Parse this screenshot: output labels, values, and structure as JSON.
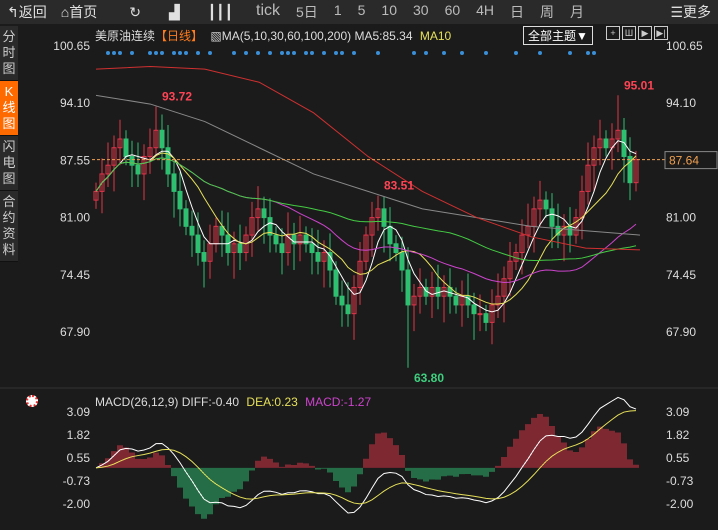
{
  "toolbar": {
    "back": "返回",
    "home": "首页",
    "refresh_icon": "refresh-icon",
    "indicator_icon": "bar-chart-icon",
    "candle_icon": "candlestick-icon",
    "periods": [
      "tick",
      "5日",
      "1",
      "5",
      "10",
      "30",
      "60",
      "4H",
      "日",
      "周",
      "月"
    ],
    "more": "更多"
  },
  "sidebar": [
    {
      "label": "分时图",
      "active": false
    },
    {
      "label": "K线图",
      "active": true
    },
    {
      "label": "闪电图",
      "active": false
    },
    {
      "label": "合约资料",
      "active": false
    }
  ],
  "header": {
    "symbol": "美原油连续",
    "period": "【日线】",
    "ma_label": "MA(5,10,30,60,100,200)",
    "ma5": "MA5:85.34",
    "ma10": "MA10",
    "theme": "全部主题▼"
  },
  "macd_header": {
    "label": "MACD(26,12,9)",
    "diff": "DIFF:-0.40",
    "dea": "DEA:0.23",
    "macd": "MACD:-1.27"
  },
  "colors": {
    "up": "#e0344a",
    "down": "#2fbf71",
    "ma5": "#ffffff",
    "ma10": "#e6e05a",
    "ma30": "#cc44cc",
    "ma60": "#44cc44",
    "ma100": "#888888",
    "ma200": "#d03030",
    "dea": "#e6e05a",
    "label_high": "#ff4455",
    "label_low": "#3fcf7f",
    "last": "#f0a050"
  },
  "chart_data": {
    "type": "candlestick",
    "y_ticks": [
      "100.65",
      "94.10",
      "87.55",
      "81.00",
      "74.45",
      "67.90"
    ],
    "ylim": [
      67.9,
      100.65
    ],
    "macd_ticks": [
      "3.09",
      "1.82",
      "0.55",
      "-0.73",
      "-2.00"
    ],
    "macd_lim": [
      -2.0,
      3.09
    ],
    "closes": [
      84,
      86,
      87,
      89,
      90,
      88,
      87,
      86,
      88,
      89,
      91,
      89,
      86,
      84,
      82,
      80,
      79,
      77,
      76,
      78,
      80,
      79,
      77,
      78,
      77,
      79,
      81,
      82,
      81,
      79,
      78,
      77,
      79,
      78,
      79,
      78,
      77,
      76,
      77,
      75,
      72,
      71,
      70,
      73,
      76,
      79,
      81,
      82,
      80,
      78,
      77,
      75,
      71,
      72,
      73,
      72,
      73,
      72,
      73,
      72,
      71,
      72,
      71,
      70,
      70,
      69,
      71,
      72,
      74,
      76,
      77,
      79,
      80,
      82,
      83,
      82,
      80,
      79,
      80,
      79,
      81,
      84,
      87,
      89,
      90,
      89,
      90,
      91,
      88,
      85,
      87.64
    ],
    "extremes": [
      {
        "index": 10,
        "high": 93.72,
        "label": "93.72"
      },
      {
        "index": 47,
        "high": 83.51,
        "label": "83.51"
      },
      {
        "index": 87,
        "high": 95.01,
        "label": "95.01"
      },
      {
        "index": 52,
        "low": 63.8,
        "label": "63.80"
      }
    ],
    "ma100": [
      95,
      94,
      92,
      89,
      86,
      84,
      82,
      81,
      80,
      79.5,
      79
    ],
    "ma200": [
      98,
      98.3,
      98,
      96.5,
      93,
      88,
      84,
      81,
      78.8,
      77.5,
      77.3
    ],
    "last_price": "87.64",
    "event_markers": [
      2,
      3,
      4,
      6,
      9,
      10,
      11,
      13,
      14,
      15,
      17,
      19,
      23,
      25,
      27,
      29,
      31,
      32,
      33,
      35,
      36,
      38,
      40,
      41,
      43,
      47,
      53,
      55,
      58,
      61,
      65,
      70,
      74,
      79,
      82,
      83
    ]
  }
}
